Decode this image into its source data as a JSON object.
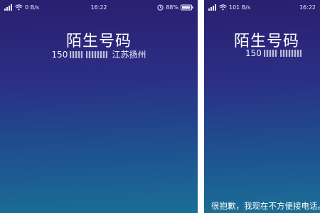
{
  "left_screen": {
    "status": {
      "net_speed": "0 B/s",
      "time": "16:22",
      "battery": "88%"
    },
    "caller": {
      "title": "陌生号码",
      "number_prefix": "150",
      "location": "江苏扬州"
    }
  },
  "right_screen": {
    "status": {
      "net_speed": "101 B/s",
      "time": "16:22"
    },
    "caller": {
      "title": "陌生号码",
      "number_prefix": "150"
    },
    "quick_reply": "很抱歉，我现在不方便接电话。"
  },
  "icons": {
    "signal": "signal-icon",
    "wifi": "wifi-icon",
    "alarm": "alarm-icon",
    "battery": "battery-icon"
  },
  "colors": {
    "bg_top": "#2a1f6f",
    "bg_mid": "#2b2f86",
    "bg_bottom": "#1a6f95"
  }
}
